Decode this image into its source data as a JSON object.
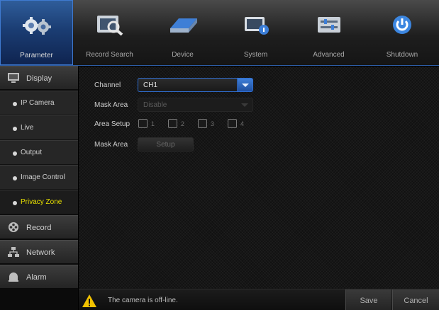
{
  "toolbar": {
    "items": [
      {
        "label": "Parameter",
        "icon": "gears-icon"
      },
      {
        "label": "Record Search",
        "icon": "record-search-icon"
      },
      {
        "label": "Device",
        "icon": "hard-drive-icon"
      },
      {
        "label": "System",
        "icon": "system-monitor-icon"
      },
      {
        "label": "Advanced",
        "icon": "advanced-panel-icon"
      },
      {
        "label": "Shutdown",
        "icon": "power-icon"
      }
    ],
    "active": "Parameter"
  },
  "sidebar": {
    "display": {
      "label": "Display",
      "icon": "monitor-icon"
    },
    "sub_items": [
      {
        "label": "IP Camera"
      },
      {
        "label": "Live"
      },
      {
        "label": "Output"
      },
      {
        "label": "Image Control"
      },
      {
        "label": "Privacy Zone",
        "active": true
      }
    ],
    "record": {
      "label": "Record",
      "icon": "film-reel-icon"
    },
    "network": {
      "label": "Network",
      "icon": "network-icon"
    },
    "alarm": {
      "label": "Alarm",
      "icon": "alarm-bell-icon"
    }
  },
  "form": {
    "channel_label": "Channel",
    "channel_value": "CH1",
    "mask_area_label": "Mask Area",
    "mask_area_value": "Disable",
    "area_setup_label": "Area Setup",
    "area_options": [
      "1",
      "2",
      "3",
      "4"
    ],
    "mask_area_setup_label": "Mask Area",
    "setup_button": "Setup"
  },
  "footer": {
    "status": "The camera is off-line.",
    "save": "Save",
    "cancel": "Cancel"
  },
  "colors": {
    "accent": "#2f6ed1",
    "active_submenu_text": "#e8e000",
    "warning": "#f2c200"
  }
}
